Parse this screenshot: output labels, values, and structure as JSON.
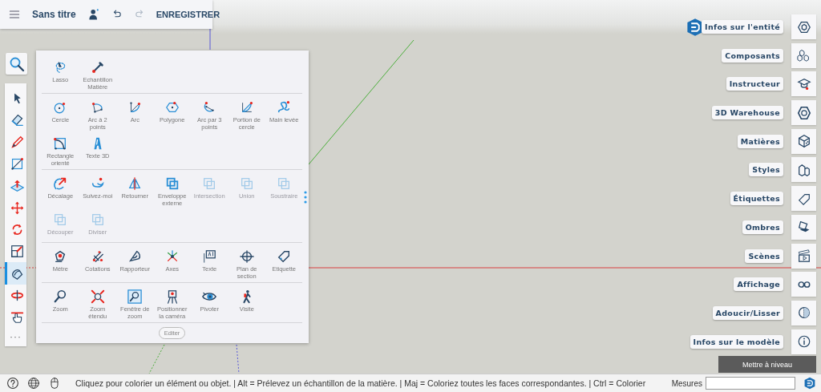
{
  "top_bar": {
    "title": "Sans titre",
    "undo": {
      "disabled": false
    },
    "redo": {
      "disabled": true
    },
    "save_label": "ENREGISTRER"
  },
  "left_toolbar": {
    "tools": [
      {
        "selected": false
      },
      {
        "selected": false
      },
      {
        "selected": false
      },
      {
        "selected": false
      },
      {
        "selected": false
      },
      {
        "selected": false
      },
      {
        "selected": false
      },
      {
        "selected": false
      },
      {
        "selected": true
      },
      {
        "selected": false
      },
      {
        "selected": false
      }
    ],
    "more_label": "···"
  },
  "tool_panel": {
    "sections": [
      {
        "tools": [
          {
            "label": "Lasso",
            "disabled": false
          },
          {
            "label": "Echantillon Matière",
            "disabled": false
          }
        ]
      },
      {
        "tools": [
          {
            "label": "Cercle",
            "disabled": false
          },
          {
            "label": "Arc à 2 points",
            "disabled": false
          },
          {
            "label": "Arc",
            "disabled": false
          },
          {
            "label": "Polygone",
            "disabled": false
          },
          {
            "label": "Arc par 3 points",
            "disabled": false
          },
          {
            "label": "Portion de cercle",
            "disabled": false
          },
          {
            "label": "Main levée",
            "disabled": false
          },
          {
            "label": "Rectangle orienté",
            "disabled": false
          },
          {
            "label": "Texte 3D",
            "disabled": false
          }
        ]
      },
      {
        "tools": [
          {
            "label": "Décalage",
            "disabled": false
          },
          {
            "label": "Suivez-moi",
            "disabled": false
          },
          {
            "label": "Retourner",
            "disabled": false
          },
          {
            "label": "Enveloppe externe",
            "disabled": false
          },
          {
            "label": "Intersection",
            "disabled": true
          },
          {
            "label": "Union",
            "disabled": true
          },
          {
            "label": "Soustraire",
            "disabled": true
          },
          {
            "label": "Découper",
            "disabled": true
          },
          {
            "label": "Diviser",
            "disabled": true
          }
        ]
      },
      {
        "tools": [
          {
            "label": "Mètre",
            "disabled": false
          },
          {
            "label": "Cotations",
            "disabled": false
          },
          {
            "label": "Rapporteur",
            "disabled": false
          },
          {
            "label": "Axes",
            "disabled": false
          },
          {
            "label": "Texte",
            "disabled": false
          },
          {
            "label": "Plan de section",
            "disabled": false
          },
          {
            "label": "Etiquette",
            "disabled": false
          }
        ]
      },
      {
        "tools": [
          {
            "label": "Zoom",
            "disabled": false
          },
          {
            "label": "Zoom étendu",
            "disabled": false
          },
          {
            "label": "Fenêtre de zoom",
            "disabled": false
          },
          {
            "label": "Positionner la caméra",
            "disabled": false
          },
          {
            "label": "Pivoter",
            "disabled": false
          },
          {
            "label": "Visite",
            "disabled": false
          }
        ]
      }
    ],
    "edit_label": "Editer"
  },
  "right_panel": {
    "items": [
      {
        "label": "Infos sur l'entité"
      },
      {
        "label": "Composants"
      },
      {
        "label": "Instructeur"
      },
      {
        "label": "3D Warehouse"
      },
      {
        "label": "Matières"
      },
      {
        "label": "Styles"
      },
      {
        "label": "Étiquettes"
      },
      {
        "label": "Ombres"
      },
      {
        "label": "Scènes"
      },
      {
        "label": "Affichage"
      },
      {
        "label": "Adoucir/Lisser"
      },
      {
        "label": "Infos sur le modèle"
      }
    ]
  },
  "upgrade_label": "Mettre à niveau",
  "status_bar": {
    "hint": "Cliquez pour colorier un élément ou objet. | Alt = Prélevez un échantillon de la matière. | Maj = Coloriez toutes les faces correspondantes. | Ctrl = Colorier",
    "measures_label": "Mesures"
  }
}
